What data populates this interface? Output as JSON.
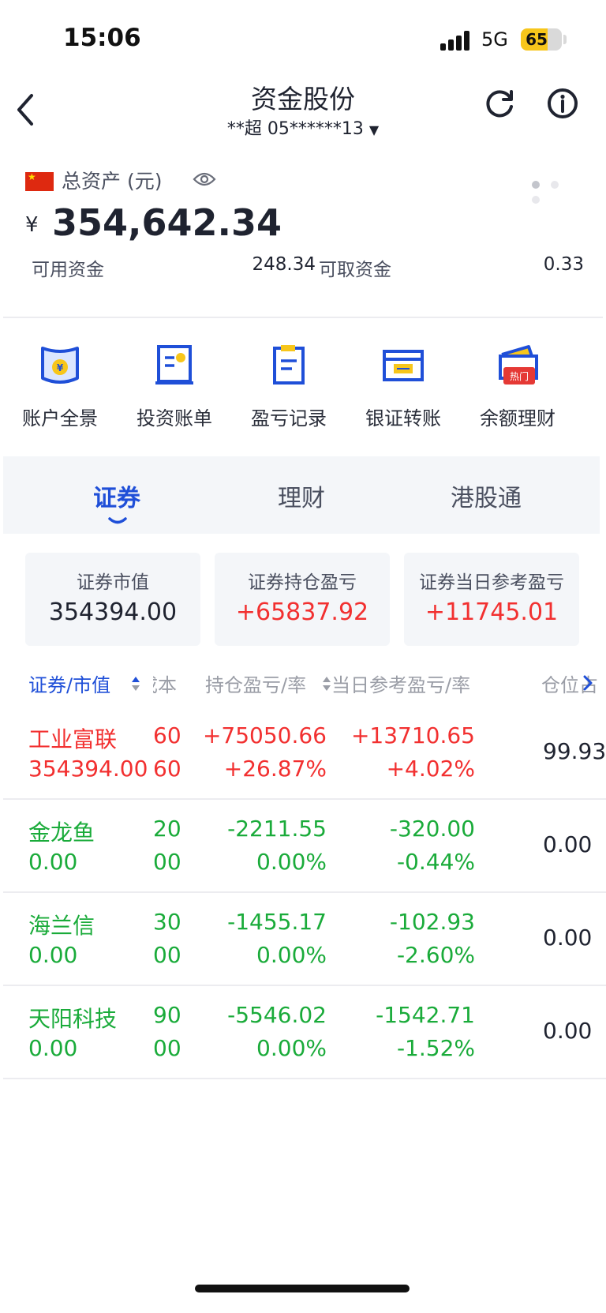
{
  "status": {
    "time": "15:06",
    "network": "5G",
    "battery": "65",
    "battery_level": 0.65
  },
  "nav": {
    "title": "资金股份",
    "account": "**超 05******13"
  },
  "asset": {
    "label": "总资产 (元)",
    "currency": "¥",
    "total": "354,642.34",
    "available_label": "可用资金",
    "available_value": "248.34",
    "withdrawable_label": "可取资金",
    "withdrawable_value": "0.33"
  },
  "quick_actions": [
    {
      "label": "账户全景",
      "icon": "account-overview-icon"
    },
    {
      "label": "投资账单",
      "icon": "investment-bill-icon"
    },
    {
      "label": "盈亏记录",
      "icon": "pnl-record-icon"
    },
    {
      "label": "银证转账",
      "icon": "bank-transfer-icon"
    },
    {
      "label": "余额理财",
      "icon": "wallet-icon",
      "badge": "热门"
    }
  ],
  "tabs": [
    {
      "label": "证券",
      "active": true
    },
    {
      "label": "理财"
    },
    {
      "label": "港股通"
    }
  ],
  "summary_cards": [
    {
      "title": "证券市值",
      "value": "354394.00"
    },
    {
      "title": "证券持仓盈亏",
      "value": "+65837.92"
    },
    {
      "title": "证券当日参考盈亏",
      "value": "+11745.01"
    }
  ],
  "table": {
    "headers": {
      "security": "证券/市值",
      "cost": "成本",
      "holding_pnl": "持仓盈亏/率",
      "daily_pnl": "当日参考盈亏/率",
      "position": "仓位占"
    },
    "rows": [
      {
        "name": "工业富联",
        "market_value": "354394.00",
        "col1_top": "60",
        "col1_bottom": "60",
        "pnl": "+75050.66",
        "pnl_rate": "+26.87%",
        "daily_pnl": "+13710.65",
        "daily_rate": "+4.02%",
        "position": "99.93"
      },
      {
        "name": "金龙鱼",
        "market_value": "0.00",
        "col1_top": "20",
        "col1_bottom": "00",
        "pnl": "-2211.55",
        "pnl_rate": "0.00%",
        "daily_pnl": "-320.00",
        "daily_rate": "-0.44%",
        "position": "0.00"
      },
      {
        "name": "海兰信",
        "market_value": "0.00",
        "col1_top": "30",
        "col1_bottom": "00",
        "pnl": "-1455.17",
        "pnl_rate": "0.00%",
        "daily_pnl": "-102.93",
        "daily_rate": "-2.60%",
        "position": "0.00"
      },
      {
        "name": "天阳科技",
        "market_value": "0.00",
        "col1_top": "90",
        "col1_bottom": "00",
        "pnl": "-5546.02",
        "pnl_rate": "0.00%",
        "daily_pnl": "-1542.71",
        "daily_rate": "-1.52%",
        "position": "0.00"
      }
    ]
  },
  "colors": {
    "accent": "#1f4fd8",
    "gain": "#f23030",
    "loss": "#1aab3a",
    "text": "#1f2330"
  }
}
